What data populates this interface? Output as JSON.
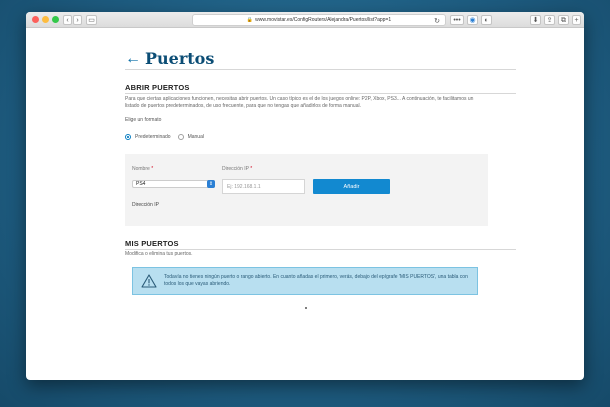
{
  "browser": {
    "url": "www.movistar.es/ConfigRouters/Alejandra/Puertos/list?app=1",
    "back_icon": "chevron-left-icon",
    "forward_icon": "chevron-right-icon"
  },
  "header": {
    "title": "Puertos",
    "back_icon": "arrow-left-icon"
  },
  "open_ports": {
    "title": "ABRIR PUERTOS",
    "description": "Para que ciertas aplicaciones funcionen, necesitas abrir puertos. Un caso típico es el de los juegos online: P2P, Xbox, PS3... A continuación, te facilitamos un listado de puertos predeterminados, de uso frecuente, para que no tengas que añadirlos de forma manual.",
    "format_label": "Elige un formato",
    "options": [
      "Predeterminado",
      "Manual"
    ],
    "selected_option": "Predeterminado",
    "name_label": "Nombre",
    "ip_label": "Dirección IP",
    "required_mark": "*",
    "name_value": "PS4",
    "ip_placeholder": "Ej: 192.168.1.1",
    "add_button": "Añadir",
    "ip_result_label": "Dirección IP"
  },
  "my_ports": {
    "title": "MIS PUERTOS",
    "subtitle": "Modifica o elimina tus puertos.",
    "notice": "Todavía no tienes ningún puerto o rango abierto. En cuanto añadas el primero, verás, debajo del epígrafe 'MIS PUERTOS', una tabla con todos los que vayas abriendo.",
    "notice_icon": "warning-icon"
  },
  "colors": {
    "background": "#1f5f84",
    "title": "#0b4d75",
    "accent": "#1289d0",
    "notice_bg": "#b8dff0"
  }
}
